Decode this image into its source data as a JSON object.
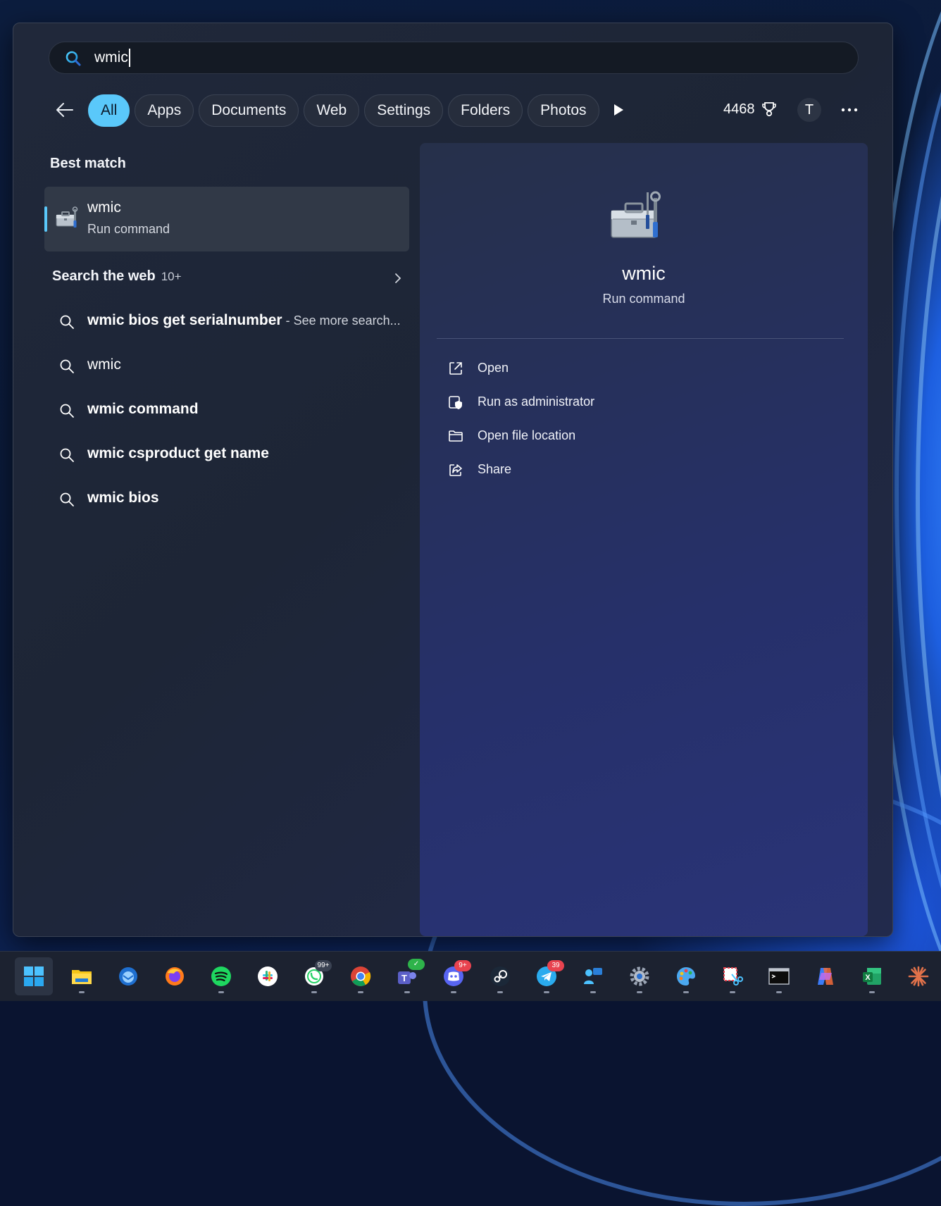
{
  "search": {
    "query": "wmic"
  },
  "filters": {
    "back_label": "Back",
    "chips": [
      "All",
      "Apps",
      "Documents",
      "Web",
      "Settings",
      "Folders",
      "Photos"
    ],
    "active": "All",
    "points": "4468",
    "avatar_initial": "T"
  },
  "best_match": {
    "heading": "Best match",
    "title": "wmic",
    "subtitle": "Run command"
  },
  "web": {
    "heading": "Search the web",
    "count": "10+",
    "results": [
      {
        "bold": "wmic bios get serialnumber",
        "hint": " - See more search..."
      },
      {
        "bold": "",
        "text": "wmic"
      },
      {
        "bold": "wmic command",
        "text": ""
      },
      {
        "bold": "wmic csproduct get name",
        "text": ""
      },
      {
        "bold": "wmic bios",
        "text": ""
      }
    ]
  },
  "preview": {
    "title": "wmic",
    "subtitle": "Run command",
    "actions": [
      "Open",
      "Run as administrator",
      "Open file location",
      "Share"
    ]
  },
  "taskbar": {
    "badges": {
      "whatsapp": "99+",
      "discord": "9+",
      "telegram": "39"
    },
    "colors": {
      "accent": "#5ac8fa",
      "badge_red": "#e8434f"
    }
  }
}
